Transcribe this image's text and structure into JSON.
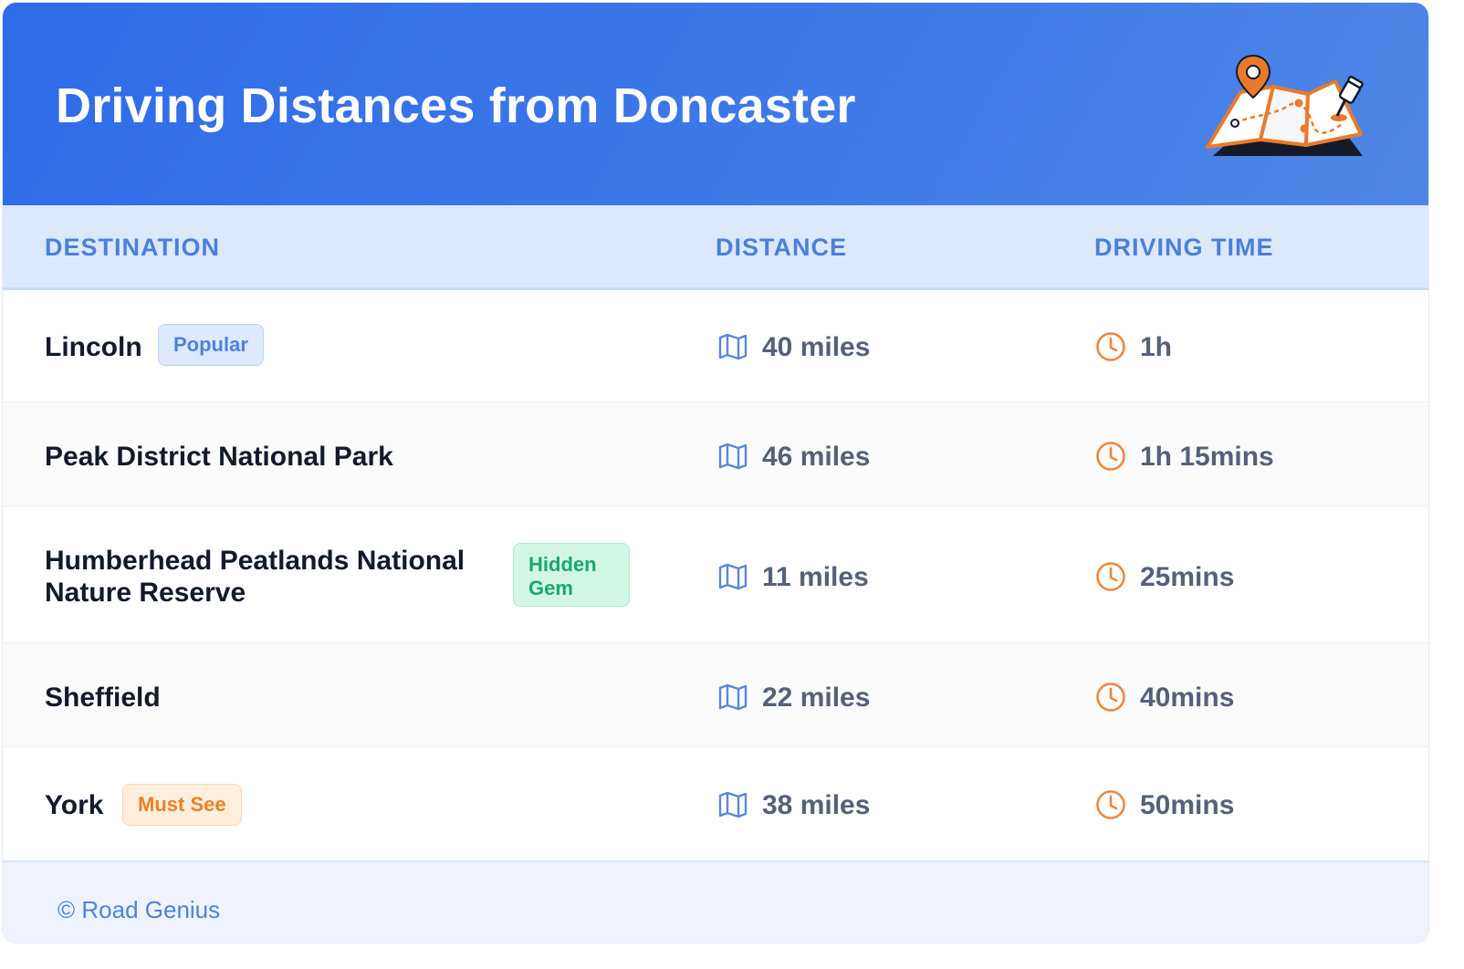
{
  "header": {
    "title": "Driving Distances from Doncaster",
    "illustration_icon": "map-with-pins-icon"
  },
  "columns": {
    "destination": "DESTINATION",
    "distance": "DISTANCE",
    "driving_time": "DRIVING TIME"
  },
  "rows": [
    {
      "destination": "Lincoln",
      "badge": "Popular",
      "badge_color": "#4f82dc",
      "distance": "40 miles",
      "time": "1h"
    },
    {
      "destination": "Peak District National Park",
      "badge": "",
      "distance": "46 miles",
      "time": "1h 15mins"
    },
    {
      "destination": "Humberhead Peatlands National Nature Reserve",
      "badge": "Hidden Gem",
      "badge_color": "#1aa96b",
      "distance": "11 miles",
      "time": "25mins"
    },
    {
      "destination": "Sheffield",
      "badge": "",
      "distance": "22 miles",
      "time": "40mins"
    },
    {
      "destination": "York",
      "badge": "Must See",
      "badge_color": "#ef7f22",
      "distance": "38 miles",
      "time": "50mins"
    }
  ],
  "icons": {
    "distance": "map-icon",
    "time": "clock-icon"
  },
  "colors": {
    "header_gradient_start": "#2f6be8",
    "header_gradient_end": "#4f86e6",
    "accent_blue": "#4a80db",
    "accent_orange": "#f0863a"
  },
  "footer": {
    "text": "© Road Genius"
  }
}
